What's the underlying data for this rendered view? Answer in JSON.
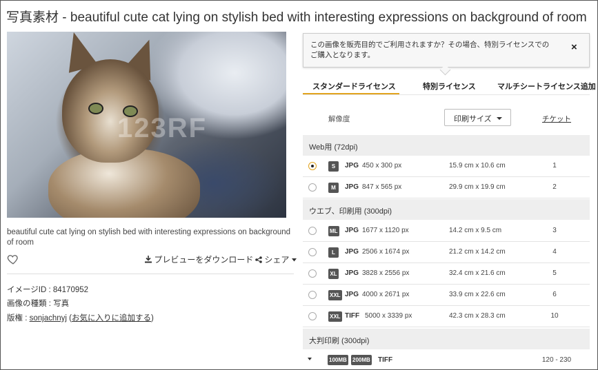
{
  "page": {
    "title": "写真素材 - beautiful cute cat lying on stylish bed with interesting expressions on background of room",
    "watermark": "123RF"
  },
  "image": {
    "caption": "beautiful cute cat lying on stylish bed with interesting expressions on background of room",
    "download_preview": "プレビューをダウンロード",
    "share": "シェア",
    "id_line": "イメージID : 84170952",
    "type_line": "画像の種類 : 写真",
    "rights_prefix": "版権 : ",
    "rights_author": "sonjachnyj",
    "favorite_open": "(",
    "favorite_link": "お気に入りに追加する",
    "favorite_close": ")"
  },
  "notice": {
    "text": "この画像を販売目的でご利用されますか？その場合、特別ライセンスでのご購入となります。",
    "close": "×"
  },
  "tabs": {
    "standard": "スタンダードライセンス",
    "special": "特別ライセンス",
    "multiseat": "マルチシートライセンス追加"
  },
  "controls": {
    "resolution_label": "解像度",
    "print_size": "印刷サイズ",
    "ticket": "チケット"
  },
  "groups": {
    "web": "Web用 (72dpi)",
    "web_print": "ウエブ、印刷用 (300dpi)",
    "large_print": "大判印刷 (300dpi)"
  },
  "rows": [
    {
      "badge": "S",
      "format": "JPG",
      "px": "450 x 300 px",
      "cm": "15.9 cm x 10.6 cm",
      "credits": "1",
      "selected": true
    },
    {
      "badge": "M",
      "format": "JPG",
      "px": "847 x 565 px",
      "cm": "29.9 cm x 19.9 cm",
      "credits": "2",
      "selected": false
    },
    {
      "badge": "ML",
      "format": "JPG",
      "px": "1677 x 1120 px",
      "cm": "14.2 cm x 9.5 cm",
      "credits": "3",
      "selected": false
    },
    {
      "badge": "L",
      "format": "JPG",
      "px": "2506 x 1674 px",
      "cm": "21.2 cm x 14.2 cm",
      "credits": "4",
      "selected": false
    },
    {
      "badge": "XL",
      "format": "JPG",
      "px": "3828 x 2556 px",
      "cm": "32.4 cm x 21.6 cm",
      "credits": "5",
      "selected": false
    },
    {
      "badge": "XXL",
      "format": "JPG",
      "px": "4000 x 2671 px",
      "cm": "33.9 cm x 22.6 cm",
      "credits": "6",
      "selected": false
    },
    {
      "badge": "XXL",
      "format": "TIFF",
      "px": "5000 x 3339 px",
      "cm": "42.3 cm x 28.3 cm",
      "credits": "10",
      "selected": false
    }
  ],
  "large": {
    "badge1": "100MB",
    "badge2": "200MB",
    "format": "TIFF",
    "credits": "120 - 230"
  },
  "colors": {
    "accent": "#e2a31d",
    "badge": "#555555",
    "group_bg": "#eeeeee"
  }
}
